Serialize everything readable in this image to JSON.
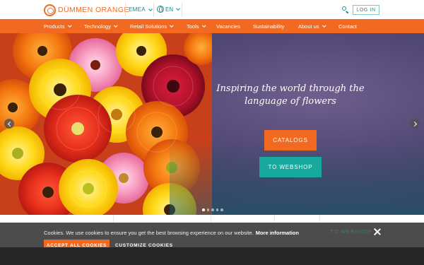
{
  "brand": {
    "name": "DÜMMEN ORANGE",
    "accent": "#f26a21",
    "teal": "#17a89e"
  },
  "header": {
    "region": "EMEA",
    "language": "EN",
    "search_icon": "search-icon",
    "login_label": "LOG IN"
  },
  "nav": {
    "items": [
      {
        "label": "Products",
        "has_dropdown": true
      },
      {
        "label": "Technology",
        "has_dropdown": true
      },
      {
        "label": "Retail Solutions",
        "has_dropdown": true
      },
      {
        "label": "Tools",
        "has_dropdown": true
      },
      {
        "label": "Vacancies",
        "has_dropdown": false
      },
      {
        "label": "Sustainability",
        "has_dropdown": false
      },
      {
        "label": "About us",
        "has_dropdown": true
      },
      {
        "label": "Contact",
        "has_dropdown": false
      }
    ]
  },
  "hero": {
    "title": "Inspiring the world through the language of flowers",
    "catalogs_label": "CATALOGS",
    "webshop_label": "TO WEBSHOP",
    "slide_count": 5,
    "active_slide": 1
  },
  "cookie": {
    "text": "Cookies. We use cookies to ensure you get the best browsing experience on our website.",
    "more_label": "More information",
    "accept_label": "ACCEPT ALL COOKIES",
    "customize_label": "CUSTOMIZE COOKIES"
  },
  "behind_banner": {
    "webshop_label": "TO WEBSHOP"
  }
}
